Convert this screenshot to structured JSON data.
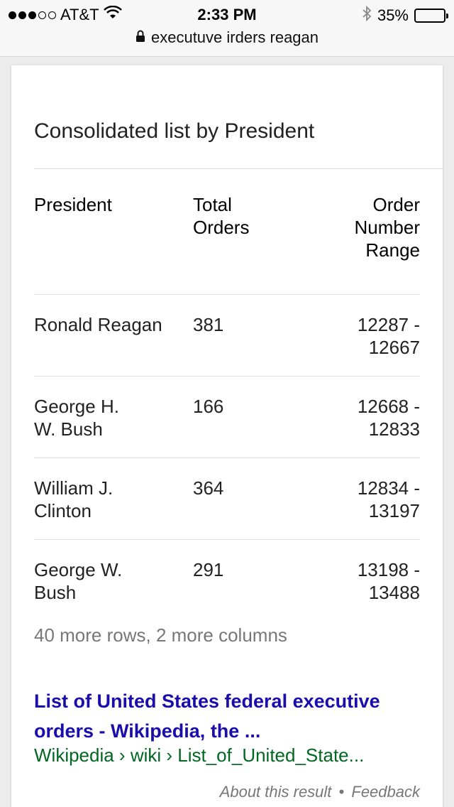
{
  "status_bar": {
    "carrier": "AT&T",
    "signal_filled": 3,
    "signal_total": 5,
    "time": "2:33 PM",
    "battery_pct_label": "35%",
    "battery_level": 0.35
  },
  "url_bar": {
    "query": "executuve irders reagan"
  },
  "card": {
    "title": "Consolidated list by President",
    "columns": {
      "president": "President",
      "total_orders": "Total Orders",
      "order_range": "Order Number Range"
    },
    "rows": [
      {
        "president": "Ronald Reagan",
        "total": "381",
        "range": "12287 - 12667"
      },
      {
        "president": "George H. W. Bush",
        "total": "166",
        "range": "12668 - 12833"
      },
      {
        "president": "William J. Clinton",
        "total": "364",
        "range": "12834 - 13197"
      },
      {
        "president": "George W. Bush",
        "total": "291",
        "range": "13198 - 13488"
      }
    ],
    "more_rows": "40 more rows, 2 more columns",
    "result_title": "List of United States federal executive orders - Wikipedia, the ...",
    "result_url": "Wikipedia › wiki › List_of_United_State...",
    "about": "About this result",
    "separator": "•",
    "feedback": "Feedback"
  },
  "colors": {
    "link": "#1a0dab",
    "url": "#006621",
    "muted": "#777777"
  }
}
